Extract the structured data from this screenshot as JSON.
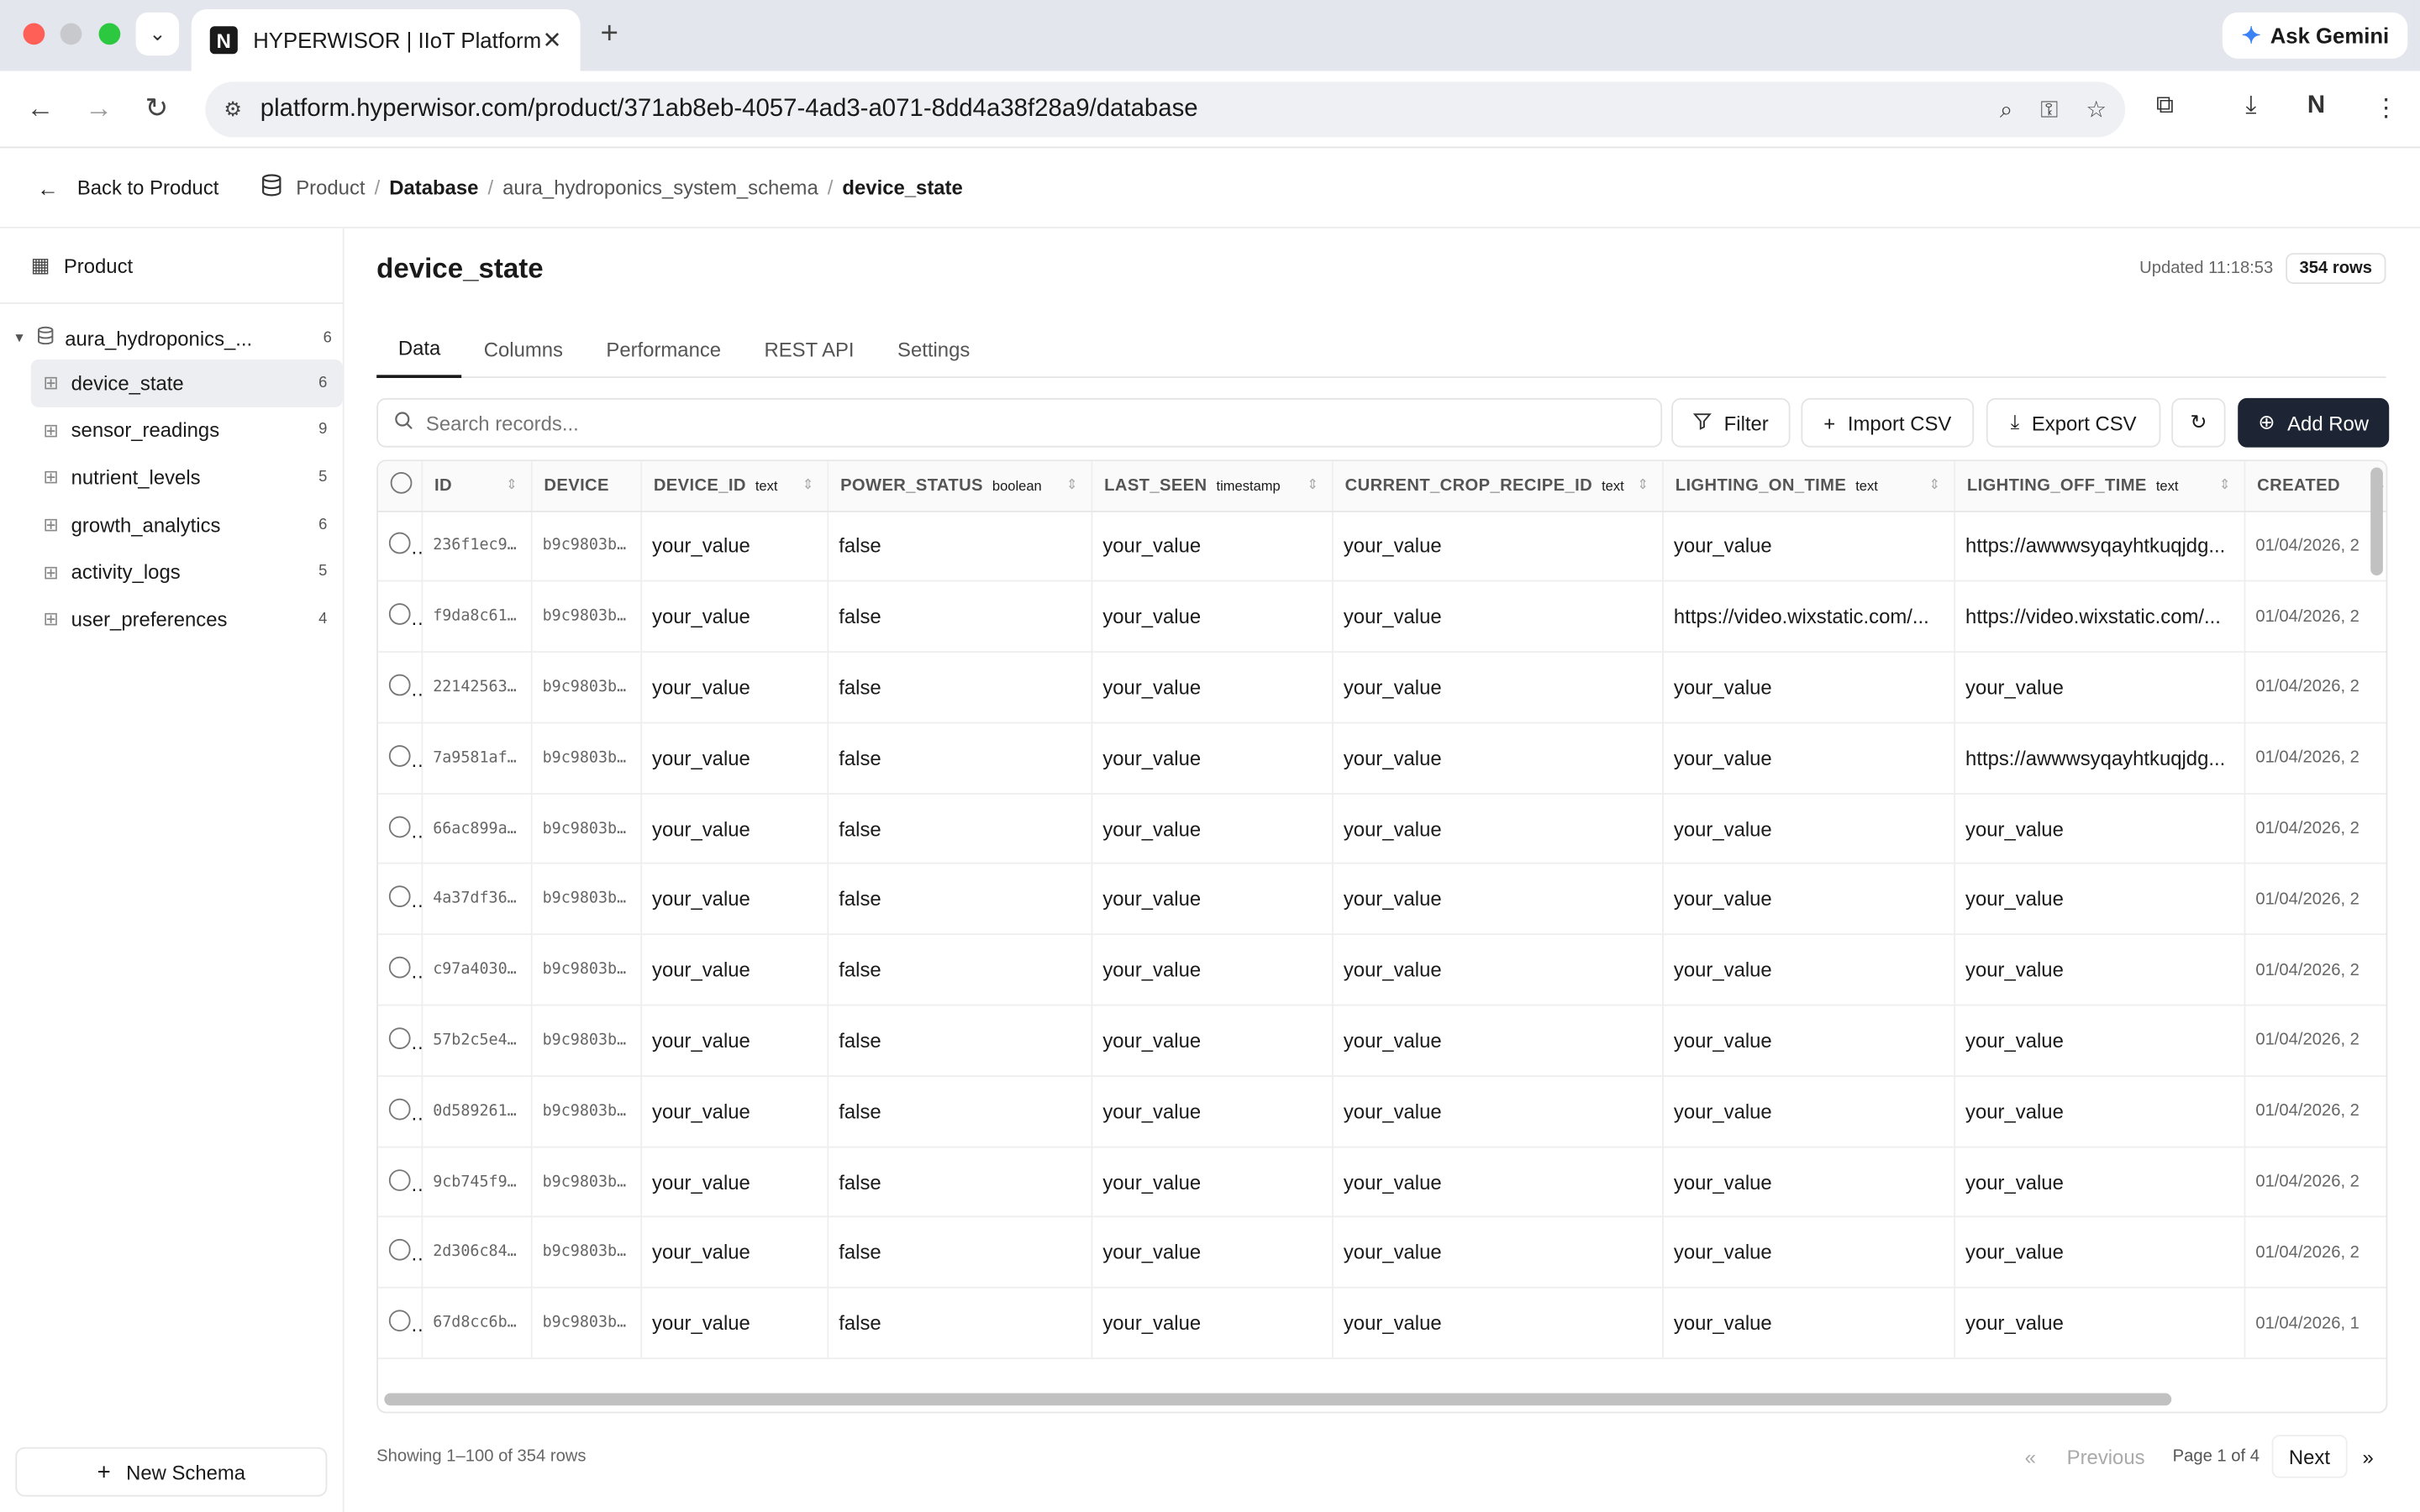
{
  "browser": {
    "tab_title": "HYPERWISOR | IIoT Platform",
    "url": "platform.hyperwisor.com/product/371ab8eb-4057-4ad3-a071-8dd4a38f28a9/database",
    "gemini_label": "Ask Gemini"
  },
  "header": {
    "back_label": "Back to Product",
    "breadcrumb": [
      "Product",
      "Database",
      "aura_hydroponics_system_schema",
      "device_state"
    ]
  },
  "sidebar": {
    "product_label": "Product",
    "schema": {
      "name": "aura_hydroponics_...",
      "count": "6"
    },
    "tables": [
      {
        "label": "device_state",
        "count": "6"
      },
      {
        "label": "sensor_readings",
        "count": "9"
      },
      {
        "label": "nutrient_levels",
        "count": "5"
      },
      {
        "label": "growth_analytics",
        "count": "6"
      },
      {
        "label": "activity_logs",
        "count": "5"
      },
      {
        "label": "user_preferences",
        "count": "4"
      }
    ],
    "new_schema_label": "New Schema"
  },
  "main": {
    "title": "device_state",
    "updated": "Updated 11:18:53",
    "rows_badge": "354 rows",
    "tabs": [
      "Data",
      "Columns",
      "Performance",
      "REST API",
      "Settings"
    ],
    "search_placeholder": "Search records...",
    "buttons": {
      "filter": "Filter",
      "import": "Import CSV",
      "export": "Export CSV",
      "add_row": "Add Row"
    }
  },
  "table": {
    "columns": [
      {
        "name": "ID",
        "type": ""
      },
      {
        "name": "DEVICE",
        "type": ""
      },
      {
        "name": "DEVICE_ID",
        "type": "text"
      },
      {
        "name": "POWER_STATUS",
        "type": "boolean"
      },
      {
        "name": "LAST_SEEN",
        "type": "timestamp"
      },
      {
        "name": "CURRENT_CROP_RECIPE_ID",
        "type": "text"
      },
      {
        "name": "LIGHTING_ON_TIME",
        "type": "text"
      },
      {
        "name": "LIGHTING_OFF_TIME",
        "type": "text"
      },
      {
        "name": "CREATED",
        "type": ""
      }
    ],
    "rows": [
      [
        "236f1ec9…",
        "b9c9803b…",
        "your_value",
        "false",
        "your_value",
        "your_value",
        "your_value",
        "https://awwwsyqayhtkuqjdg...",
        "01/04/2026, 2"
      ],
      [
        "f9da8c61…",
        "b9c9803b…",
        "your_value",
        "false",
        "your_value",
        "your_value",
        "https://video.wixstatic.com/...",
        "https://video.wixstatic.com/...",
        "01/04/2026, 2"
      ],
      [
        "22142563…",
        "b9c9803b…",
        "your_value",
        "false",
        "your_value",
        "your_value",
        "your_value",
        "your_value",
        "01/04/2026, 2"
      ],
      [
        "7a9581af…",
        "b9c9803b…",
        "your_value",
        "false",
        "your_value",
        "your_value",
        "your_value",
        "https://awwwsyqayhtkuqjdg...",
        "01/04/2026, 2"
      ],
      [
        "66ac899a…",
        "b9c9803b…",
        "your_value",
        "false",
        "your_value",
        "your_value",
        "your_value",
        "your_value",
        "01/04/2026, 2"
      ],
      [
        "4a37df36…",
        "b9c9803b…",
        "your_value",
        "false",
        "your_value",
        "your_value",
        "your_value",
        "your_value",
        "01/04/2026, 2"
      ],
      [
        "c97a4030…",
        "b9c9803b…",
        "your_value",
        "false",
        "your_value",
        "your_value",
        "your_value",
        "your_value",
        "01/04/2026, 2"
      ],
      [
        "57b2c5e4…",
        "b9c9803b…",
        "your_value",
        "false",
        "your_value",
        "your_value",
        "your_value",
        "your_value",
        "01/04/2026, 2"
      ],
      [
        "0d589261…",
        "b9c9803b…",
        "your_value",
        "false",
        "your_value",
        "your_value",
        "your_value",
        "your_value",
        "01/04/2026, 2"
      ],
      [
        "9cb745f9…",
        "b9c9803b…",
        "your_value",
        "false",
        "your_value",
        "your_value",
        "your_value",
        "your_value",
        "01/04/2026, 2"
      ],
      [
        "2d306c84…",
        "b9c9803b…",
        "your_value",
        "false",
        "your_value",
        "your_value",
        "your_value",
        "your_value",
        "01/04/2026, 2"
      ],
      [
        "67d8cc6b…",
        "b9c9803b…",
        "your_value",
        "false",
        "your_value",
        "your_value",
        "your_value",
        "your_value",
        "01/04/2026, 1"
      ]
    ]
  },
  "footer": {
    "showing": "Showing 1–100 of 354 rows",
    "first": "«",
    "previous": "Previous",
    "page_info": "Page 1 of 4",
    "next": "Next",
    "last": "»"
  },
  "colors": {
    "primary_button": "#1d2433",
    "active_sidebar": "#eceef1"
  }
}
